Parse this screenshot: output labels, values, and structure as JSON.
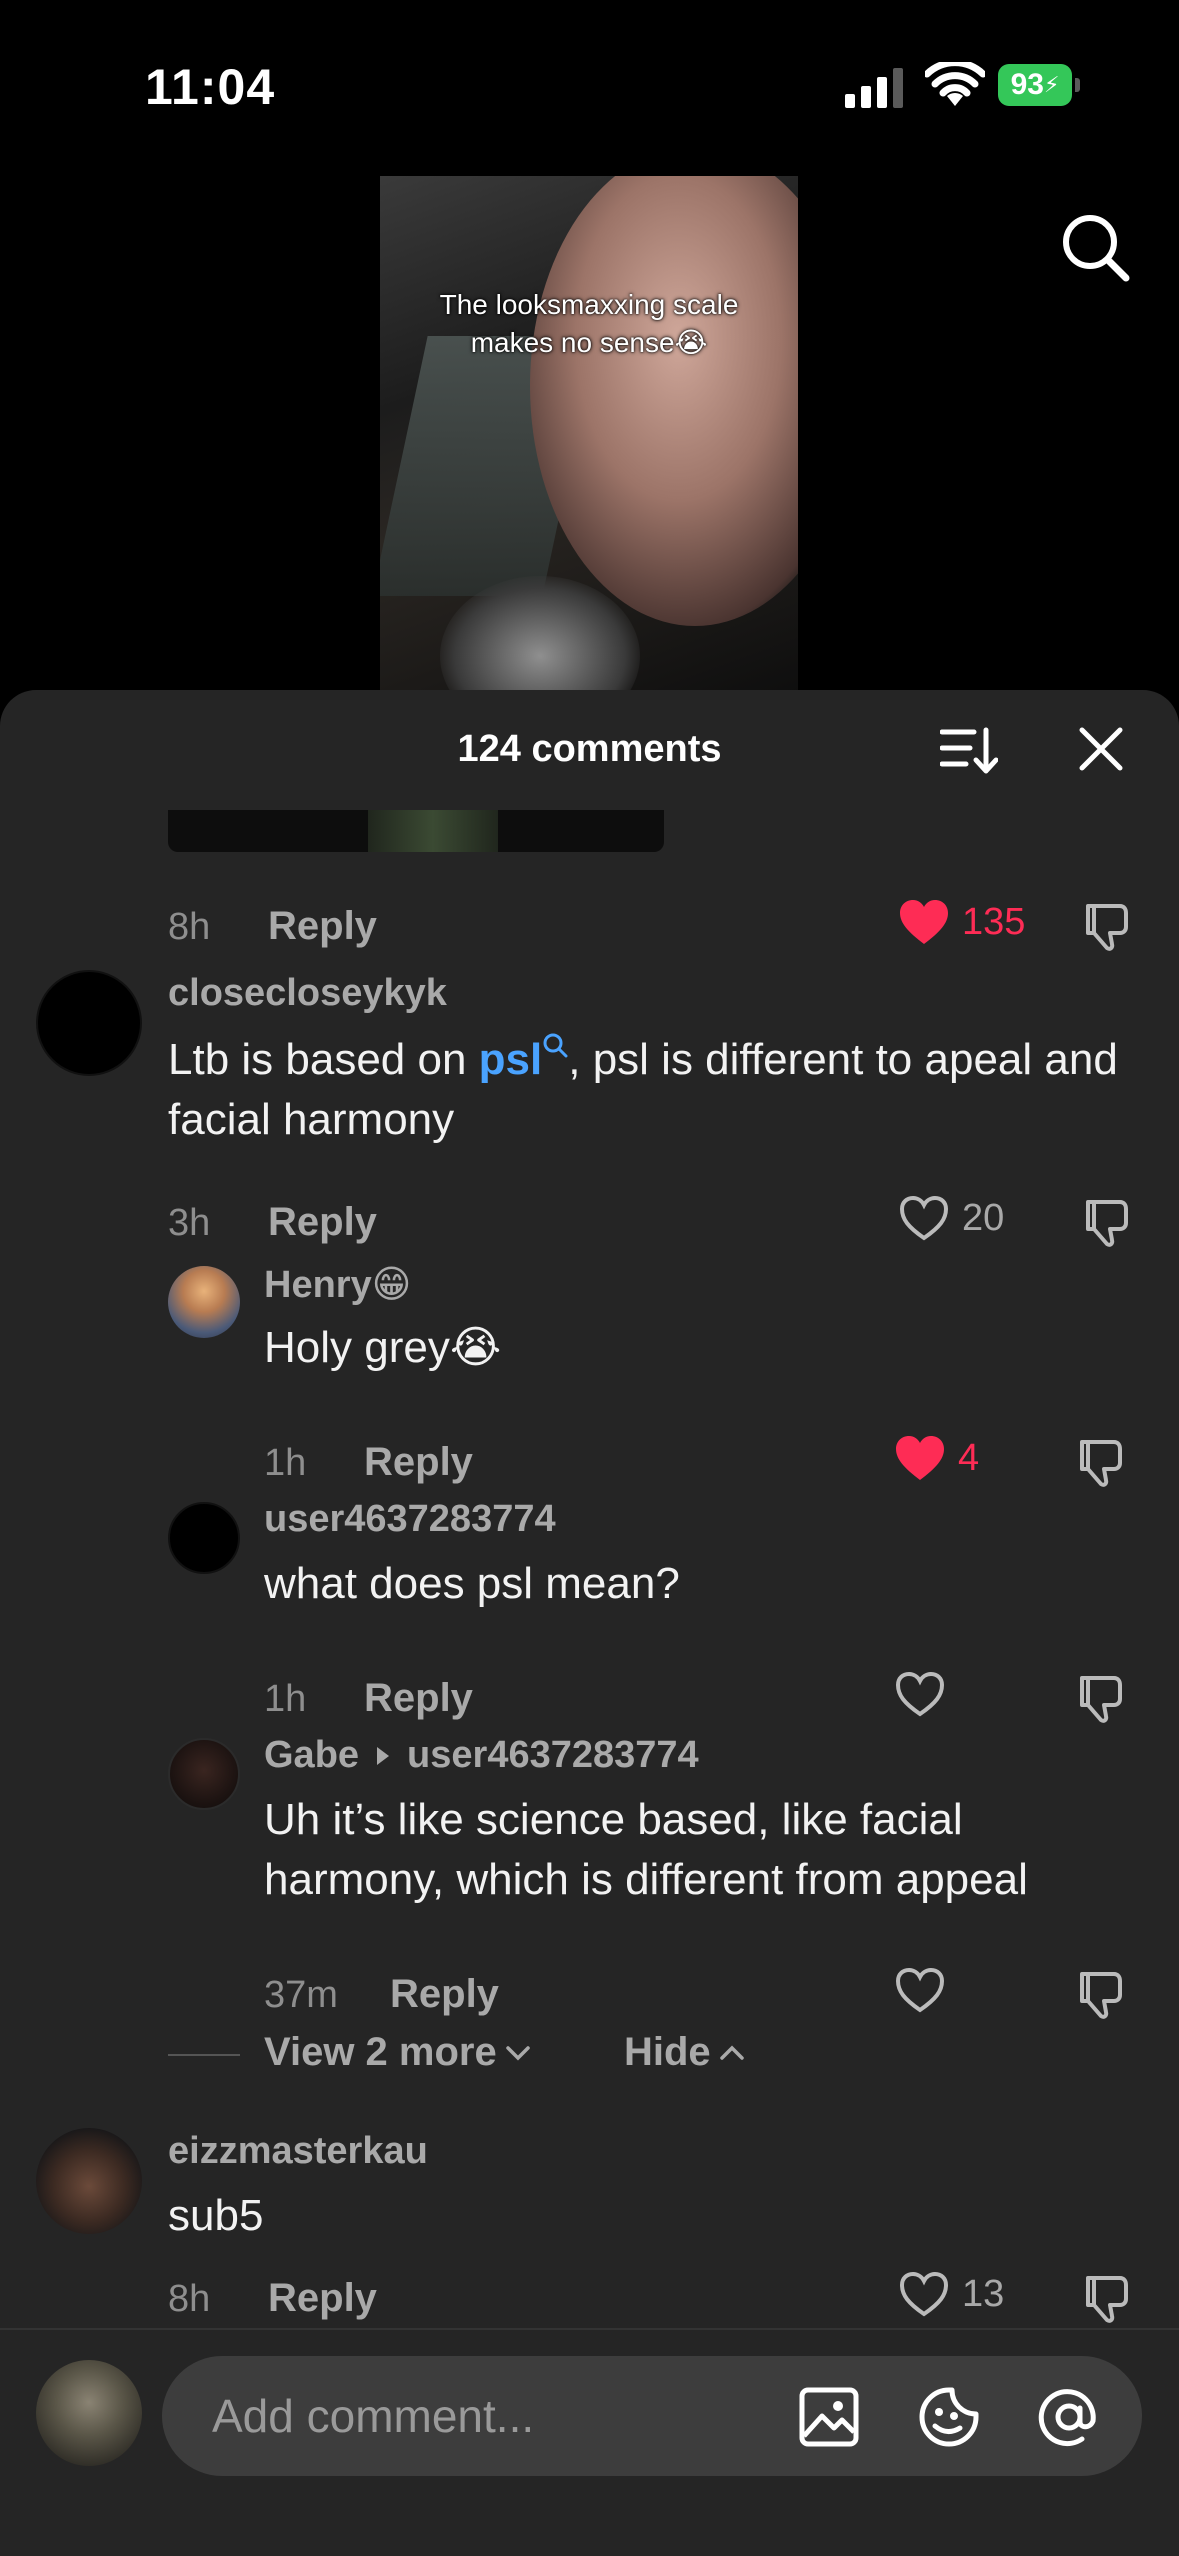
{
  "status_bar": {
    "time": "11:04",
    "battery": "93"
  },
  "video": {
    "caption": "The looksmaxxing scale\nmakes no sense😭"
  },
  "sheet": {
    "title": "124 comments"
  },
  "comments": [
    {
      "time": "8h",
      "reply": "Reply",
      "likes": "135"
    },
    {
      "username": "closecloseykyk",
      "text_before": "Ltb is based on ",
      "link": "psl",
      "text_after": ", psl is different to apeal and facial harmony",
      "time": "3h",
      "reply": "Reply",
      "likes": "20"
    },
    {
      "username": "Henry😁",
      "text": "Holy grey😭",
      "time": "1h",
      "reply": "Reply",
      "likes": "4"
    },
    {
      "username": "user4637283774",
      "text": "what does psl mean?",
      "time": "1h",
      "reply": "Reply"
    },
    {
      "username": "Gabe",
      "reply_to": "user4637283774",
      "text": "Uh it’s like science based, like facial harmony, which is different from appeal",
      "time": "37m",
      "reply": "Reply"
    },
    {
      "username": "eizzmasterkau",
      "text": "sub5",
      "time": "8h",
      "reply": "Reply",
      "likes": "13"
    }
  ],
  "thread": {
    "view_more": "View 2 more",
    "hide": "Hide"
  },
  "composer": {
    "placeholder": "Add comment..."
  },
  "colors": {
    "like_red": "#fe2c55",
    "link_blue": "#4aa3ff",
    "sheet_bg": "#252525"
  }
}
